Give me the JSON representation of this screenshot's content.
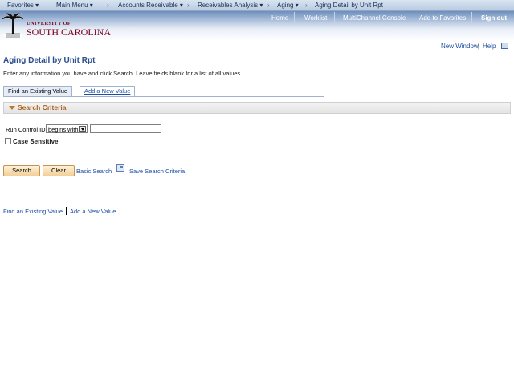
{
  "topnav": {
    "items": [
      "Favorites ▾",
      "Main Menu ▾",
      "Accounts Receivable ▾",
      "Receivables Analysis ▾",
      "Aging ▾",
      "Aging Detail by Unit Rpt"
    ]
  },
  "header": {
    "logo_line1": "UNIVERSITY OF",
    "logo_line2": "SOUTH CAROLINA",
    "links": {
      "home": "Home",
      "worklist": "Worklist",
      "multichannel": "MultiChannel Console",
      "favorites": "Add to Favorites",
      "signout": "Sign out"
    }
  },
  "utility": {
    "new_window": "New Window",
    "help": "Help"
  },
  "page": {
    "title": "Aging Detail by Unit Rpt",
    "instructions": "Enter any information you have and click Search. Leave fields blank for a list of all values."
  },
  "tabs": {
    "find": "Find an Existing Value",
    "add": "Add a New Value"
  },
  "criteria": {
    "header": "Search Criteria",
    "run_control_label": "Run Control ID:",
    "operator": "begins with",
    "value": "",
    "case_sensitive": "Case Sensitive"
  },
  "buttons": {
    "search": "Search",
    "clear": "Clear",
    "basic_search": "Basic Search",
    "save_search": "Save Search Criteria"
  },
  "bottom": {
    "find": "Find an Existing Value",
    "add": "Add a New Value"
  }
}
